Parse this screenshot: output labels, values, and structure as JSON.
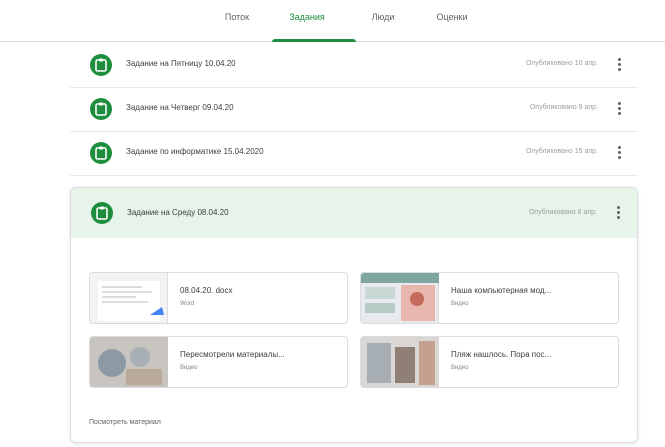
{
  "tabs": [
    {
      "label": "Поток"
    },
    {
      "label": "Задания"
    },
    {
      "label": "Люди"
    },
    {
      "label": "Оценки"
    }
  ],
  "assignments": [
    {
      "title": "Задание на Пятницу 10.04.20",
      "meta": "Опубликовано 10 апр.",
      "icon": "assignment-icon"
    },
    {
      "title": "Задание на Четверг 09.04.20",
      "meta": "Опубликовано 9 апр.",
      "icon": "assignment-icon"
    },
    {
      "title": "Задание по информатике 15.04.2020",
      "meta": "Опубликовано 15 апр.",
      "icon": "assignment-icon"
    }
  ],
  "expanded": {
    "title": "Задание на Среду 08.04.20",
    "meta": "Опубликовано 8 апр.",
    "icon": "assignment-icon",
    "attachments": [
      {
        "title": "08.04.20. docx",
        "type": "Word"
      },
      {
        "title": "Наша компьютерная мод...",
        "type": "Видео"
      },
      {
        "title": "Пересмотрели материалы...",
        "type": "Видео"
      },
      {
        "title": "Пляж нашлось. Пора пос...",
        "type": "Видео"
      }
    ],
    "view_link": "Посмотреть материал"
  },
  "colors": {
    "accent": "#1e8e3e",
    "expanded_bg": "#e6f4ea"
  }
}
